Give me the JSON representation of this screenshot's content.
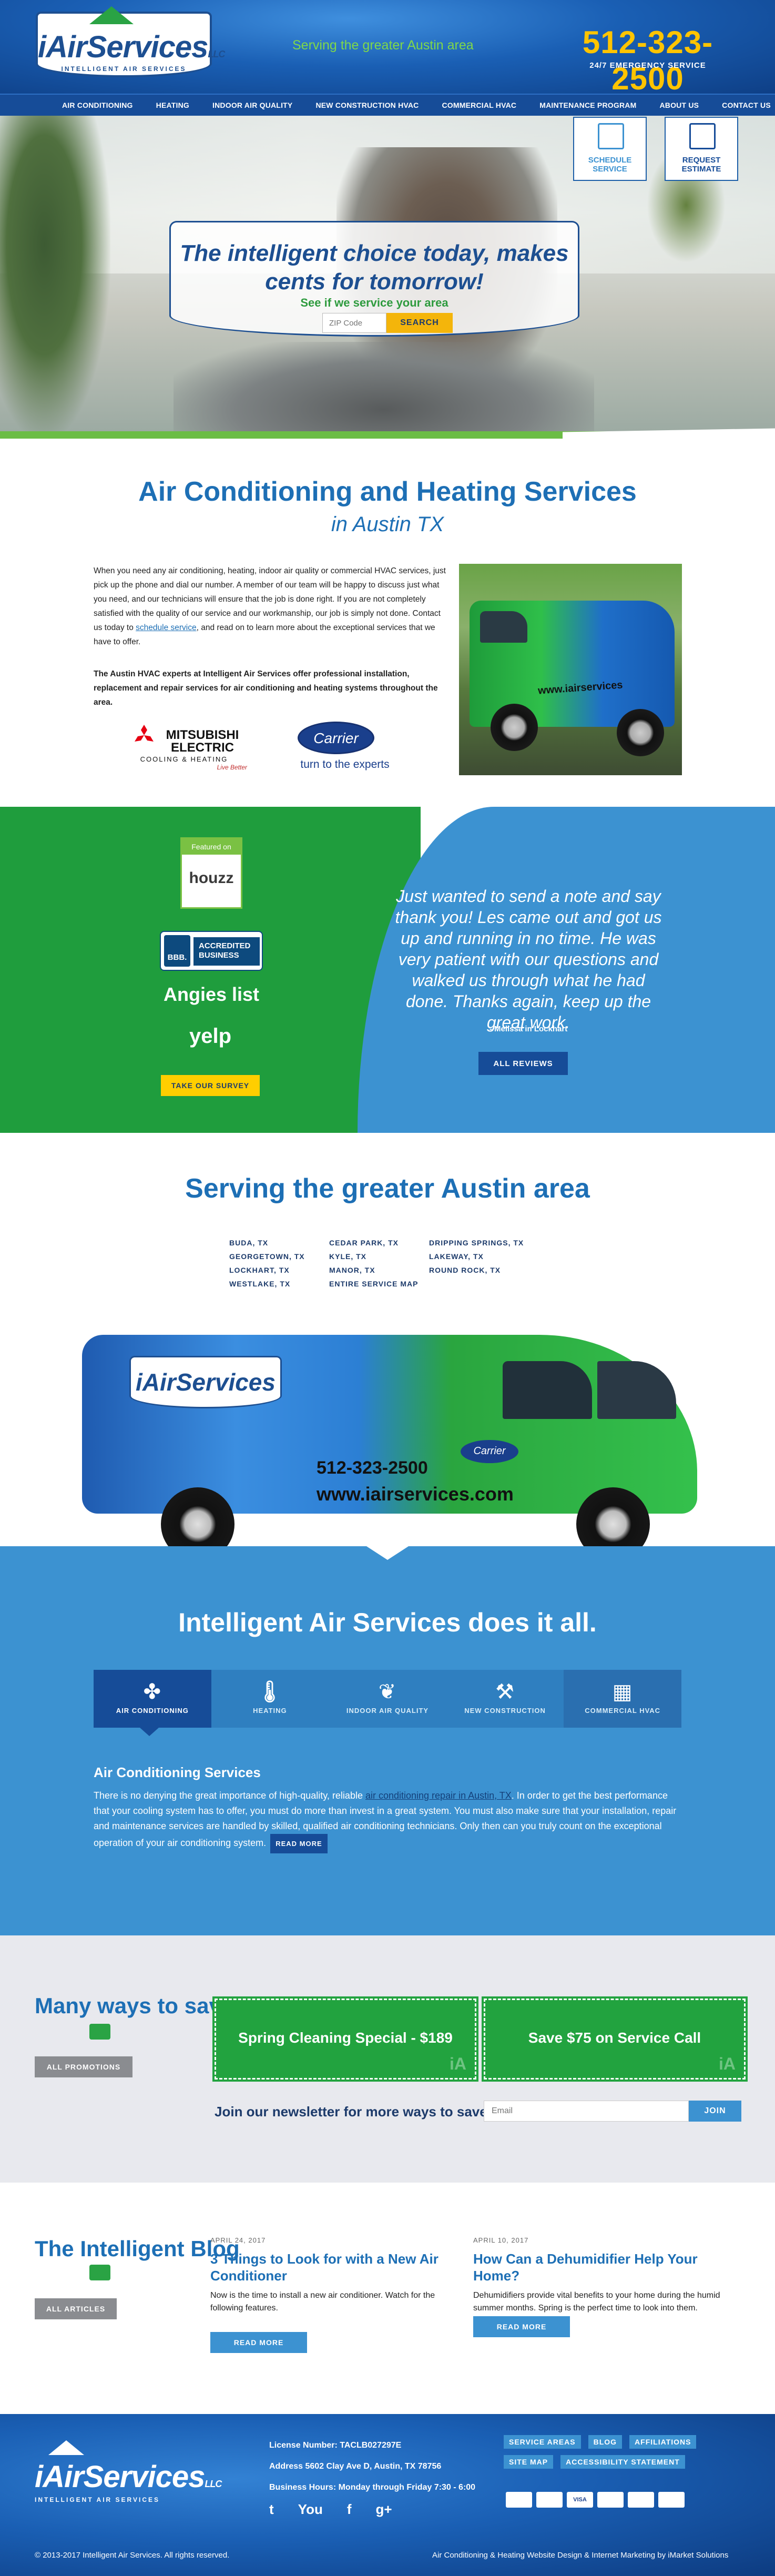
{
  "header": {
    "logo": "iAirServices",
    "logo_llc": "LLC",
    "logo_sub": "INTELLIGENT AIR SERVICES",
    "tagline": "Serving the greater Austin area",
    "phone": "512-323-2500",
    "emergency": "24/7 EMERGENCY SERVICE"
  },
  "nav": [
    "AIR CONDITIONING",
    "HEATING",
    "INDOOR AIR QUALITY",
    "NEW CONSTRUCTION HVAC",
    "COMMERCIAL HVAC",
    "MAINTENANCE PROGRAM",
    "ABOUT US",
    "CONTACT US"
  ],
  "hero": {
    "schedule_label": "SCHEDULE SERVICE",
    "estimate_label": "REQUEST ESTIMATE",
    "headline": "The intelligent choice today, makes cents for tomorrow!",
    "check_text": "See if we service your area",
    "zip_placeholder": "ZIP Code",
    "search_label": "SEARCH"
  },
  "intro": {
    "title": "Air Conditioning and Heating Services",
    "subtitle": "in Austin TX",
    "para1_a": "When you need any air conditioning, heating, indoor air quality or commercial HVAC services, just pick up the phone and dial our number. A member of our team will be happy to discuss just what you need, and our technicians will ensure that the job is done right. If you are not completely satisfied with the quality of our service and our workmanship, our job is simply not done. Contact us today to ",
    "para1_link": "schedule service",
    "para1_b": ", and read on to learn more about the exceptional services that we have to offer.",
    "para2": "The Austin HVAC experts at Intelligent Air Services offer professional installation, replacement and repair services for air conditioning and heating systems throughout the area.",
    "mitsubishi": "MITSUBISHI ELECTRIC",
    "mitsubishi_sub": "COOLING & HEATING",
    "mitsubishi_slogan": "Live Better",
    "carrier": "Carrier",
    "carrier_slogan": "turn to the experts"
  },
  "van_photo": {
    "text": "www.iairservices"
  },
  "reviews": {
    "houzz_top": "Featured on",
    "houzz": "houzz",
    "bbb_mark": "BBB.",
    "bbb_text": "ACCREDITED BUSINESS",
    "angies": "Angies list",
    "yelp": "yelp",
    "survey_label": "TAKE OUR SURVEY",
    "quote": "Just wanted to send a note and say thank you! Les came out and got us up and running in no time. He was very patient with our questions and walked us through what he had done. Thanks again, keep up the great work.",
    "author": "- Melissa in Lockhart",
    "all_reviews_label": "ALL REVIEWS"
  },
  "area": {
    "title": "Serving the greater Austin area",
    "cities": [
      "BUDA, TX",
      "CEDAR PARK, TX",
      "DRIPPING SPRINGS, TX",
      "GEORGETOWN, TX",
      "KYLE, TX",
      "LAKEWAY, TX",
      "LOCKHART, TX",
      "MANOR, TX",
      "ROUND ROCK, TX",
      "WESTLAKE, TX",
      "ENTIRE SERVICE MAP",
      ""
    ],
    "van_logo": "iAirServices",
    "van_phone": "512-323-2500",
    "van_web": "www.iairservices.com",
    "van_carrier": "Carrier"
  },
  "doall": {
    "title": "Intelligent Air Services does it all.",
    "tabs": [
      {
        "label": "AIR CONDITIONING",
        "icon": "fan-icon"
      },
      {
        "label": "HEATING",
        "icon": "thermometer-icon"
      },
      {
        "label": "INDOOR AIR QUALITY",
        "icon": "leaf-icon"
      },
      {
        "label": "NEW CONSTRUCTION",
        "icon": "drill-icon"
      },
      {
        "label": "COMMERCIAL HVAC",
        "icon": "building-icon"
      }
    ],
    "section_title": "Air Conditioning Services",
    "text_a": "There is no denying the great importance of high-quality, reliable ",
    "text_link": "air conditioning repair in Austin, TX",
    "text_b": ". In order to get the best performance that your cooling system has to offer, you must do more than invest in a great system. You must also make sure that your installation, repair and maintenance services are handled by skilled, qualified air conditioning technicians. Only then can you truly count on the exceptional operation of your air conditioning system.",
    "read_more": "READ MORE"
  },
  "promo": {
    "title": "Many ways to save",
    "all_label": "ALL PROMOTIONS",
    "coupons": [
      "Spring Cleaning Special - $189",
      "Save $75 on Service Call"
    ],
    "coupon_mark": "iA",
    "newsletter": "Join our newsletter for more ways to save:",
    "email_placeholder": "Email",
    "join_label": "JOIN"
  },
  "blog": {
    "title": "The Intelligent Blog",
    "all_label": "ALL ARTICLES",
    "posts": [
      {
        "date": "APRIL 24, 2017",
        "title": "3 Things to Look for with a New Air Conditioner",
        "excerpt": "Now is the time to install a new air conditioner. Watch for the following features.",
        "btn": "READ MORE"
      },
      {
        "date": "APRIL 10, 2017",
        "title": "How Can a Dehumidifier Help Your Home?",
        "excerpt": "Dehumidifiers provide vital benefits to your home during the humid summer months. Spring is the perfect time to look into them.",
        "btn": "READ MORE"
      }
    ]
  },
  "footer": {
    "logo": "iAirServices",
    "logo_llc": "LLC",
    "logo_sub": "INTELLIGENT AIR SERVICES",
    "license": "License Number: TACLB027297E",
    "address": "Address 5602 Clay Ave D, Austin, TX 78756",
    "hours": "Business Hours: Monday through Friday 7:30 - 6:00",
    "social": [
      "t",
      "You",
      "f",
      "g+"
    ],
    "links": [
      "SERVICE AREAS",
      "BLOG",
      "AFFILIATIONS",
      "SITE MAP",
      "ACCESSIBILITY STATEMENT"
    ],
    "cards": [
      "",
      "",
      "VISA",
      "",
      "",
      ""
    ],
    "copyright": "© 2013-2017 Intelligent Air Services. All rights reserved.",
    "credit": "Air Conditioning & Heating Website Design & Internet Marketing by iMarket Solutions"
  }
}
